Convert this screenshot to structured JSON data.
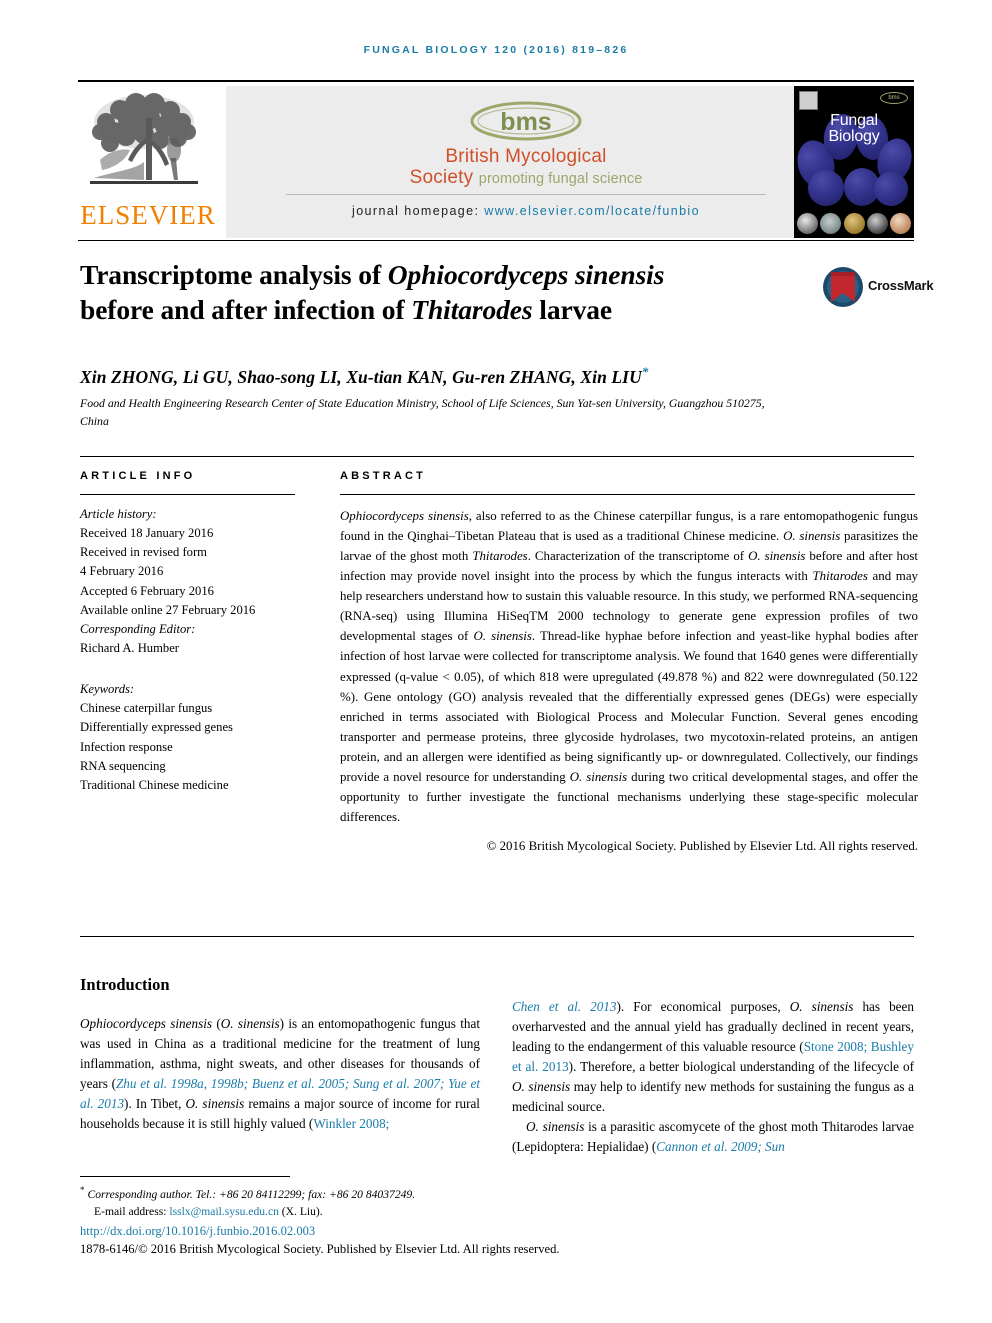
{
  "running_head": "FUNGAL BIOLOGY 120 (2016) 819–826",
  "masthead": {
    "publisher_name": "ELSEVIER",
    "society_line1": "British Mycological",
    "society_line2": "Society",
    "society_tagline": "promoting fungal science",
    "society_mark": "bms",
    "homepage_label": "journal homepage:",
    "homepage_url": "www.elsevier.com/locate/funbio",
    "cover_title_line1": "Fungal",
    "cover_title_line2": "Biology",
    "cover_mini_mark": "bms"
  },
  "article": {
    "title_line1_plain": "Transcriptome analysis of ",
    "title_line1_italic": "Ophiocordyceps sinensis",
    "title_line2_plain": "before and after infection of ",
    "title_line2_italic": "Thitarodes",
    "title_line2_tail": " larvae",
    "crossmark_label": "CrossMark",
    "authors": "Xin ZHONG, Li GU, Shao-song LI, Xu-tian KAN, Gu-ren ZHANG, Xin LIU",
    "author_star": "*",
    "affiliation": "Food and Health Engineering Research Center of State Education Ministry, School of Life Sciences, Sun Yat-sen University, Guangzhou 510275, China"
  },
  "sections": {
    "info_header": "ARTICLE INFO",
    "abstract_header": "ABSTRACT"
  },
  "article_info": {
    "history_label": "Article history:",
    "history": [
      "Received 18 January 2016",
      "Received in revised form",
      "4 February 2016",
      "Accepted 6 February 2016",
      "Available online 27 February 2016"
    ],
    "editor_label": "Corresponding Editor:",
    "editor_name": "Richard A. Humber",
    "keywords_label": "Keywords:",
    "keywords": [
      "Chinese caterpillar fungus",
      "Differentially expressed genes",
      "Infection response",
      "RNA sequencing",
      "Traditional Chinese medicine"
    ]
  },
  "abstract": {
    "p1_a": "Ophiocordyceps sinensis",
    "p1_b": ", also referred to as the Chinese caterpillar fungus, is a rare entomopathogenic fungus found in the Qinghai–Tibetan Plateau that is used as a traditional Chinese medicine. ",
    "p1_c": "O. sinensis",
    "p1_d": " parasitizes the larvae of the ghost moth ",
    "p1_e": "Thitarodes",
    "p1_f": ". Characterization of the transcriptome of ",
    "p1_g": "O. sinensis",
    "p1_h": " before and after host infection may provide novel insight into the process by which the fungus interacts with ",
    "p1_i": "Thitarodes",
    "p1_j": " and may help researchers understand how to sustain this valuable resource. In this study, we performed RNA-sequencing (RNA-seq) using Illumina HiSeqTM 2000 technology to generate gene expression profiles of two developmental stages of ",
    "p1_k": "O. sinensis",
    "p1_l": ". Thread-like hyphae before infection and yeast-like hyphal bodies after infection of host larvae were collected for transcriptome analysis. We found that 1640 genes were differentially expressed (q-value < 0.05), of which 818 were upregulated (49.878 %) and 822 were downregulated (50.122 %). Gene ontology (GO) analysis revealed that the differentially expressed genes (DEGs) were especially enriched in terms associated with Biological Process and Molecular Function. Several genes encoding transporter and permease proteins, three glycoside hydrolases, two mycotoxin-related proteins, an antigen protein, and an allergen were identified as being significantly up- or downregulated. Collectively, our findings provide a novel resource for understanding ",
    "p1_m": "O. sinensis",
    "p1_n": " during two critical developmental stages, and offer the opportunity to further investigate the functional mechanisms underlying these stage-specific molecular differences.",
    "copyright": "© 2016 British Mycological Society. Published by Elsevier Ltd. All rights reserved."
  },
  "intro": {
    "heading": "Introduction",
    "left_a": "Ophiocordyceps sinensis",
    "left_b": " (",
    "left_c": "O. sinensis",
    "left_d": ") is an entomopathogenic fungus that was used in China as a traditional medicine for the treatment of lung inflammation, asthma, night sweats, and other diseases for thousands of years (",
    "left_cite1": "Zhu et al. 1998a, 1998b; Buenz et al. 2005; Sung et al. 2007; Yue et al. 2013",
    "left_e": "). In Tibet, ",
    "left_f": "O. sinensis",
    "left_g": " remains a major source of income for rural households because it is still highly valued (",
    "left_cite2": "Winkler 2008;",
    "right_cite1": "Chen et al. 2013",
    "right_a": "). For economical purposes, ",
    "right_b": "O. sinensis",
    "right_c": " has been overharvested and the annual yield has gradually declined in recent years, leading to the endangerment of this valuable resource (",
    "right_cite2": "Stone 2008; Bushley et al. 2013",
    "right_d": "). Therefore, a better biological understanding of the lifecycle of ",
    "right_e": "O. sinensis",
    "right_f": " may help to identify new methods for sustaining the fungus as a medicinal source.",
    "right_p2_a": "O. sinensis",
    "right_p2_b": " is a parasitic ascomycete of the ghost moth Thitarodes larvae (Lepidoptera: Hepialidae) (",
    "right_p2_cite": "Cannon et al. 2009; Sun"
  },
  "footer": {
    "star": "*",
    "corresponding": "Corresponding author. Tel.: +86 20 84112299; fax: +86 20 84037249.",
    "email_label": "E-mail address: ",
    "email": "lsslx@mail.sysu.edu.cn",
    "email_suffix": " (X. Liu).",
    "doi": "http://dx.doi.org/10.1016/j.funbio.2016.02.003",
    "issn": "1878-6146/© 2016 British Mycological Society. Published by Elsevier Ltd. All rights reserved."
  },
  "colors": {
    "link_blue": "#1a7aa8",
    "elsevier_orange": "#f08000",
    "bms_red": "#d1502a",
    "bms_green": "#9aa86a"
  }
}
